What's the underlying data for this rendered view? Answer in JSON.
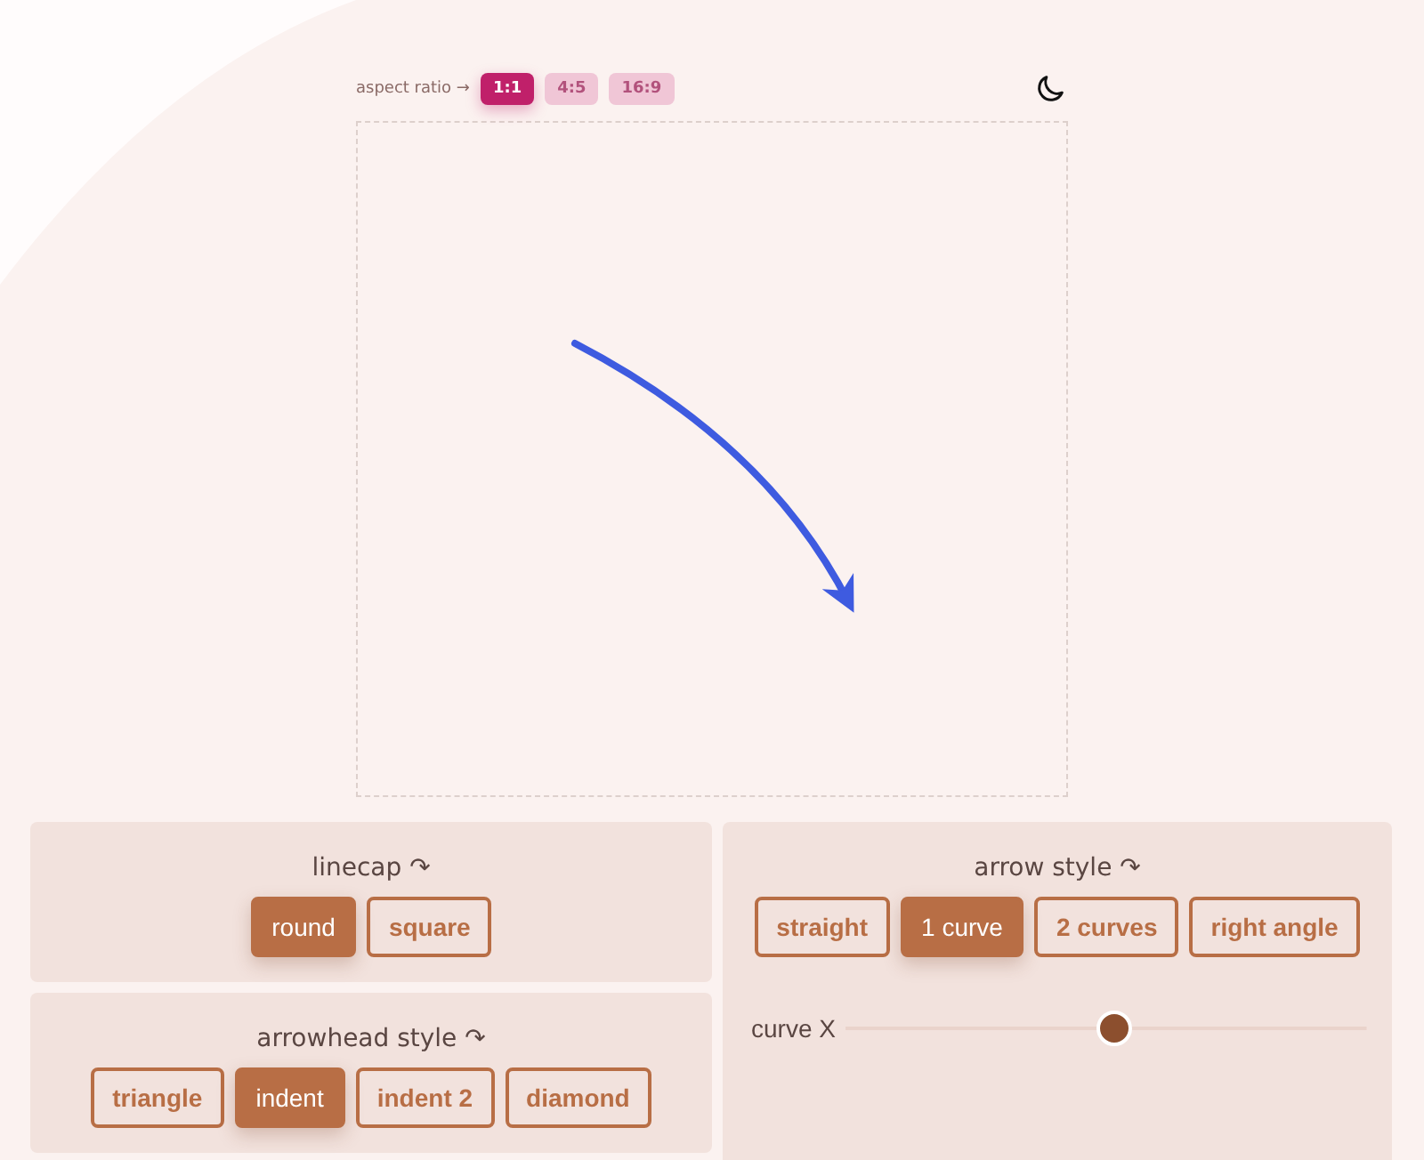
{
  "aspect_ratio": {
    "label": "aspect ratio →",
    "options": [
      {
        "label": "1:1",
        "selected": true
      },
      {
        "label": "4:5",
        "selected": false
      },
      {
        "label": "16:9",
        "selected": false
      }
    ]
  },
  "linecap": {
    "title": "linecap ↷",
    "options": [
      {
        "label": "round",
        "selected": true
      },
      {
        "label": "square",
        "selected": false
      }
    ]
  },
  "arrowhead_style": {
    "title": "arrowhead style ↷",
    "options": [
      {
        "label": "triangle",
        "selected": false
      },
      {
        "label": "indent",
        "selected": true
      },
      {
        "label": "indent 2",
        "selected": false
      },
      {
        "label": "diamond",
        "selected": false
      }
    ]
  },
  "arrow_style": {
    "title": "arrow style ↷",
    "options": [
      {
        "label": "straight",
        "selected": false
      },
      {
        "label": "1 curve",
        "selected": true
      },
      {
        "label": "2 curves",
        "selected": false
      },
      {
        "label": "right angle",
        "selected": false
      }
    ],
    "slider": {
      "label": "curve X",
      "level": 0.51
    }
  }
}
